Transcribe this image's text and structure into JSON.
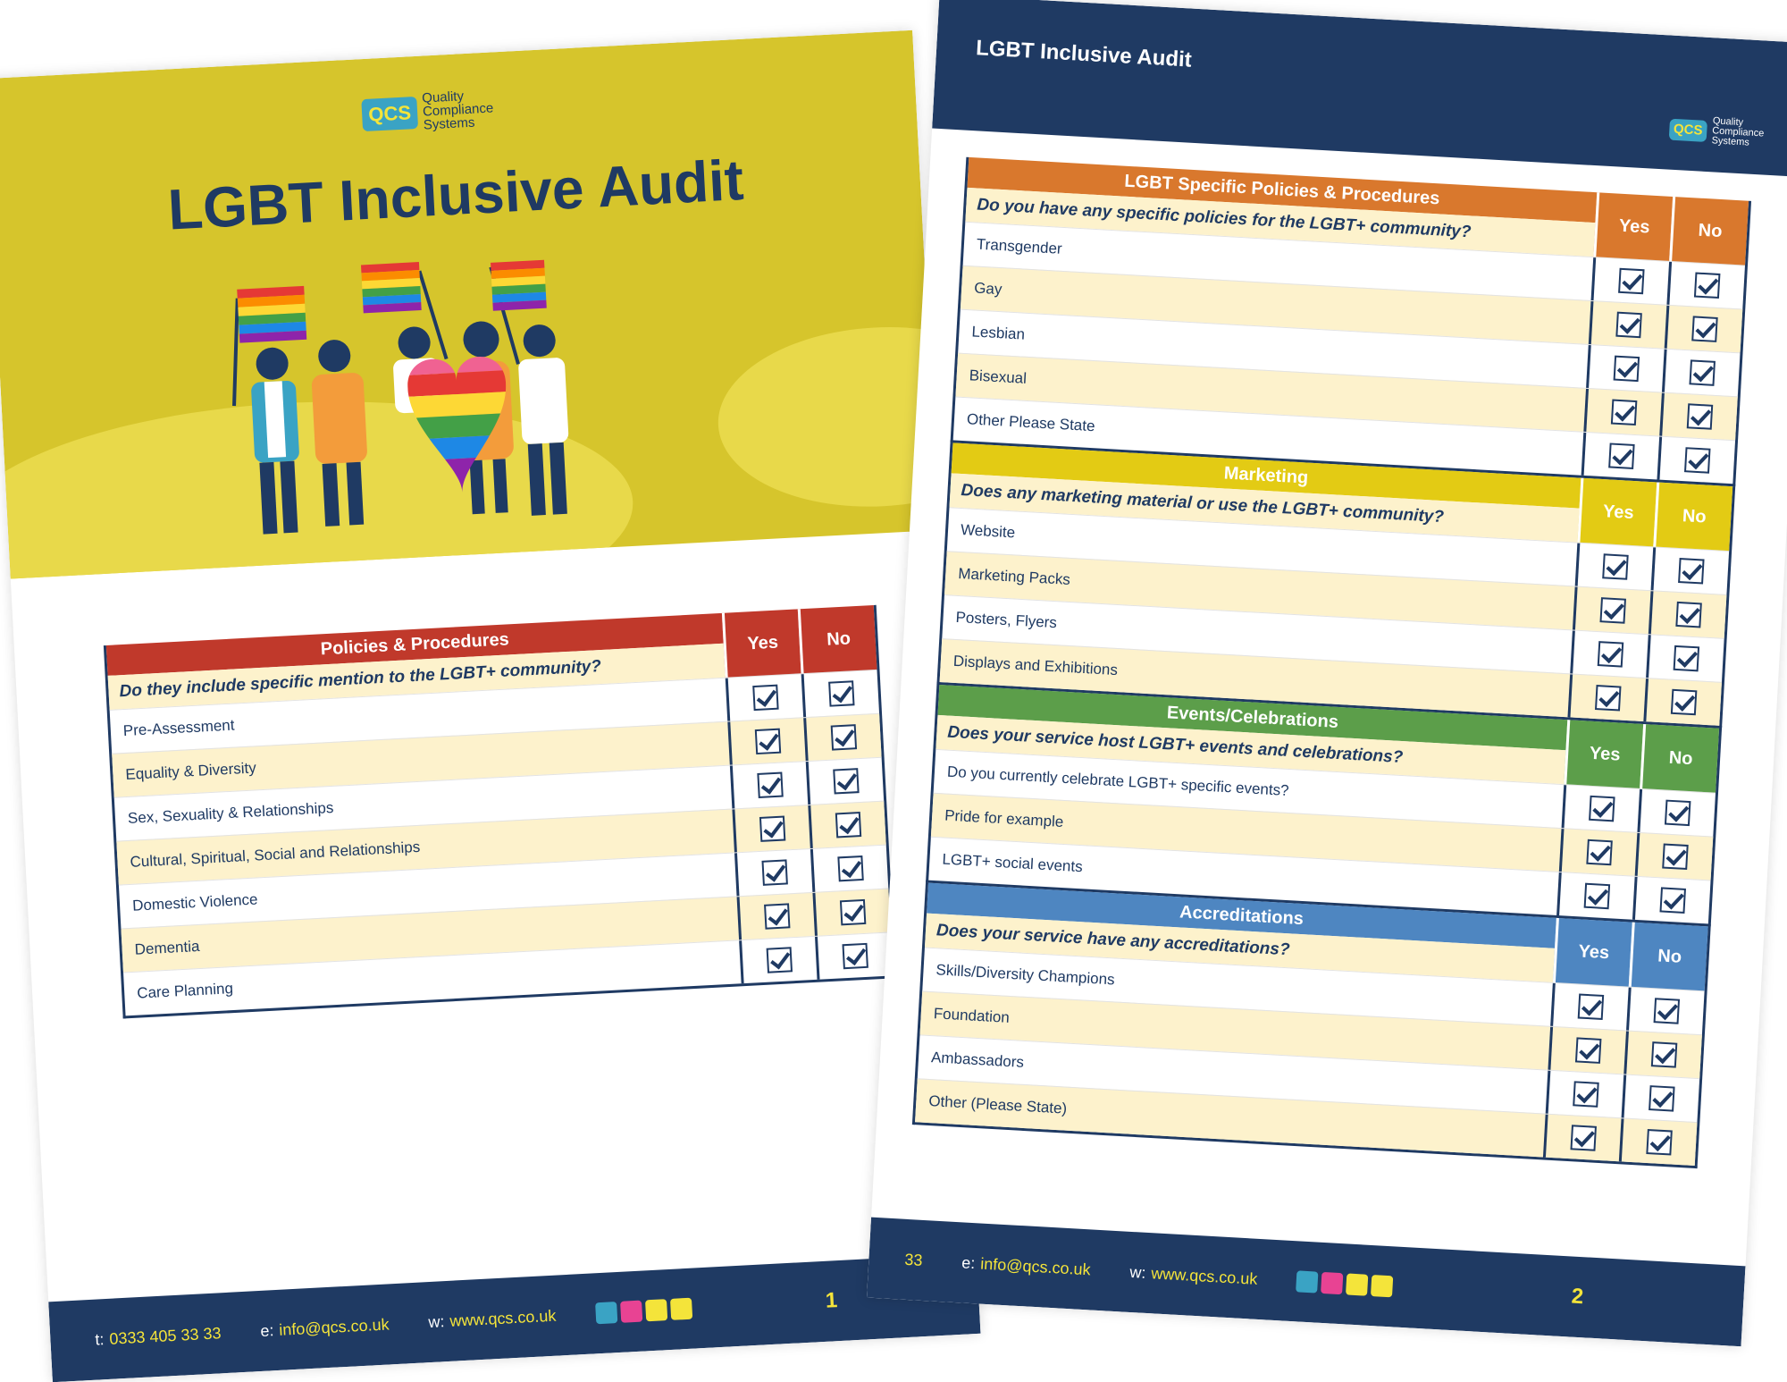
{
  "logo": {
    "mark": "QCS",
    "line1": "Quality",
    "line2": "Compliance",
    "line3": "Systems"
  },
  "colors": {
    "navy": "#1f3a63",
    "yellow": "#f4e43a",
    "cover": "#d6c52c",
    "red": "#c0392b",
    "orange": "#d9782d",
    "mustard": "#e3cb14",
    "green": "#5c9e4a",
    "blue": "#4e86c1"
  },
  "page1": {
    "title": "LGBT Inclusive Audit",
    "table": {
      "heading": "Policies & Procedures",
      "question": "Do they include specific mention to the LGBT+ community?",
      "yes": "Yes",
      "no": "No",
      "rows": [
        "Pre-Assessment",
        "Equality & Diversity",
        "Sex, Sexuality & Relationships",
        "Cultural, Spiritual, Social and Relationships",
        "Domestic Violence",
        "Dementia",
        "Care Planning"
      ]
    },
    "footer": {
      "tel_label": "t:",
      "tel": "0333 405 33 33",
      "email_label": "e:",
      "email": "info@qcs.co.uk",
      "web_label": "w:",
      "web": "www.qcs.co.uk",
      "page": "1"
    }
  },
  "page2": {
    "header_title": "LGBT Inclusive Audit",
    "sections": [
      {
        "heading": "LGBT Specific Policies & Procedures",
        "question": "Do you have any specific policies for the LGBT+ community?",
        "yes": "Yes",
        "no": "No",
        "color": "#d9782d",
        "rows": [
          "Transgender",
          "Gay",
          "Lesbian",
          "Bisexual",
          "Other Please State"
        ]
      },
      {
        "heading": "Marketing",
        "question": "Does any marketing material or use the LGBT+ community?",
        "yes": "Yes",
        "no": "No",
        "color": "#e3cb14",
        "rows": [
          "Website",
          "Marketing Packs",
          "Posters, Flyers",
          "Displays and Exhibitions"
        ]
      },
      {
        "heading": "Events/Celebrations",
        "question": "Does your service host LGBT+ events and celebrations?",
        "yes": "Yes",
        "no": "No",
        "color": "#5c9e4a",
        "rows": [
          "Do you currently celebrate LGBT+ specific events?",
          "Pride for example",
          "LGBT+ social events"
        ]
      },
      {
        "heading": "Accreditations",
        "question": "Does your service have any accreditations?",
        "yes": "Yes",
        "no": "No",
        "color": "#4e86c1",
        "rows": [
          "Skills/Diversity Champions",
          "Foundation",
          "Ambassadors",
          "Other (Please State)"
        ]
      }
    ],
    "footer": {
      "tel": "33",
      "email_label": "e:",
      "email": "info@qcs.co.uk",
      "web_label": "w:",
      "web": "www.qcs.co.uk",
      "page": "2"
    }
  }
}
